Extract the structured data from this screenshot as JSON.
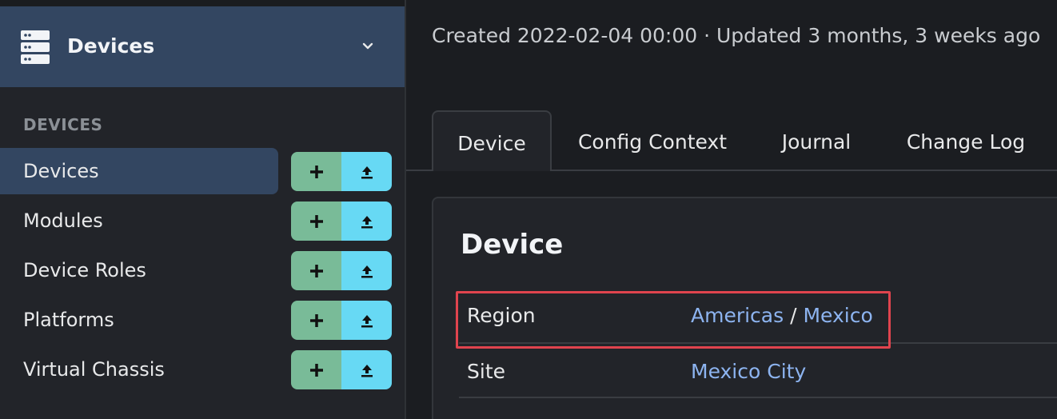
{
  "sidebar": {
    "section_title": "Devices",
    "section_icon": "server-icon",
    "group_label": "DEVICES",
    "items": [
      {
        "label": "Devices",
        "active": true
      },
      {
        "label": "Modules",
        "active": false
      },
      {
        "label": "Device Roles",
        "active": false
      },
      {
        "label": "Platforms",
        "active": false
      },
      {
        "label": "Virtual Chassis",
        "active": false
      }
    ],
    "add_icon": "plus-icon",
    "import_icon": "upload-icon"
  },
  "main": {
    "meta": "Created 2022-02-04 00:00 · Updated 3 months, 3 weeks ago",
    "tabs": [
      {
        "label": "Device",
        "active": true
      },
      {
        "label": "Config Context",
        "active": false
      },
      {
        "label": "Journal",
        "active": false
      },
      {
        "label": "Change Log",
        "active": false
      }
    ],
    "card": {
      "title": "Device",
      "rows": [
        {
          "label": "Region",
          "value_parts": [
            "Americas",
            "Mexico"
          ],
          "separator": " / "
        },
        {
          "label": "Site",
          "value": "Mexico City"
        }
      ]
    }
  },
  "colors": {
    "sidebar_active": "#334661",
    "btn_add": "#79bb98",
    "btn_import": "#67d9f4",
    "link": "#8db4f0",
    "highlight": "#e0444e"
  }
}
